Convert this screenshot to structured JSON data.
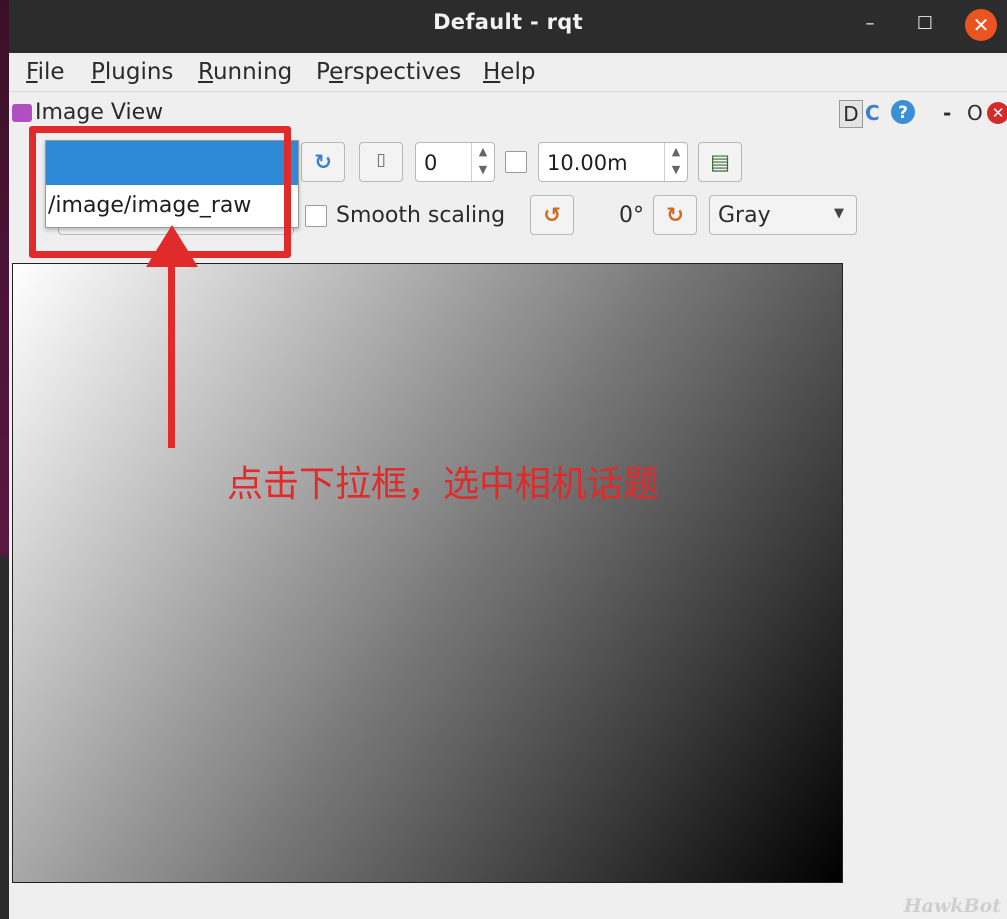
{
  "window": {
    "title": "Default - rqt",
    "min": "–",
    "max": "☐",
    "close": "✕"
  },
  "menubar": {
    "items": [
      {
        "label": "File",
        "key": "F",
        "rest": "ile"
      },
      {
        "label": "Plugins",
        "key": "P",
        "rest": "lugins"
      },
      {
        "label": "Running",
        "key": "R",
        "rest": "unning"
      },
      {
        "label": "Perspectives",
        "key": "e",
        "pre": "P",
        "rest": "rspectives"
      },
      {
        "label": "Help",
        "key": "H",
        "rest": "elp"
      }
    ]
  },
  "panel": {
    "title": "Image View",
    "btn_d": "D",
    "btn_reload": "C",
    "btn_help": "?",
    "btn_dash": "-",
    "btn_o": "O",
    "btn_close": "✕"
  },
  "toolbar": {
    "refresh_icon": "↻",
    "stop_icon": "▯",
    "frame_value": "0",
    "time_value": "10.00m",
    "save_icon": "▤",
    "smooth_scaling_label": "Smooth scaling",
    "rotate_left_icon": "↺",
    "rotation_value": "0°",
    "rotate_right_icon": "↻",
    "color_mode": "Gray"
  },
  "dropdown": {
    "selected": "",
    "options": [
      "/image/image_raw"
    ]
  },
  "annotation": {
    "text": "点击下拉框，选中相机话题"
  },
  "watermark": "HawkBot",
  "colors": {
    "highlight": "#e12a2a",
    "selection": "#2e8ad6",
    "titlebar": "#2c2c2c",
    "close": "#e95420"
  }
}
